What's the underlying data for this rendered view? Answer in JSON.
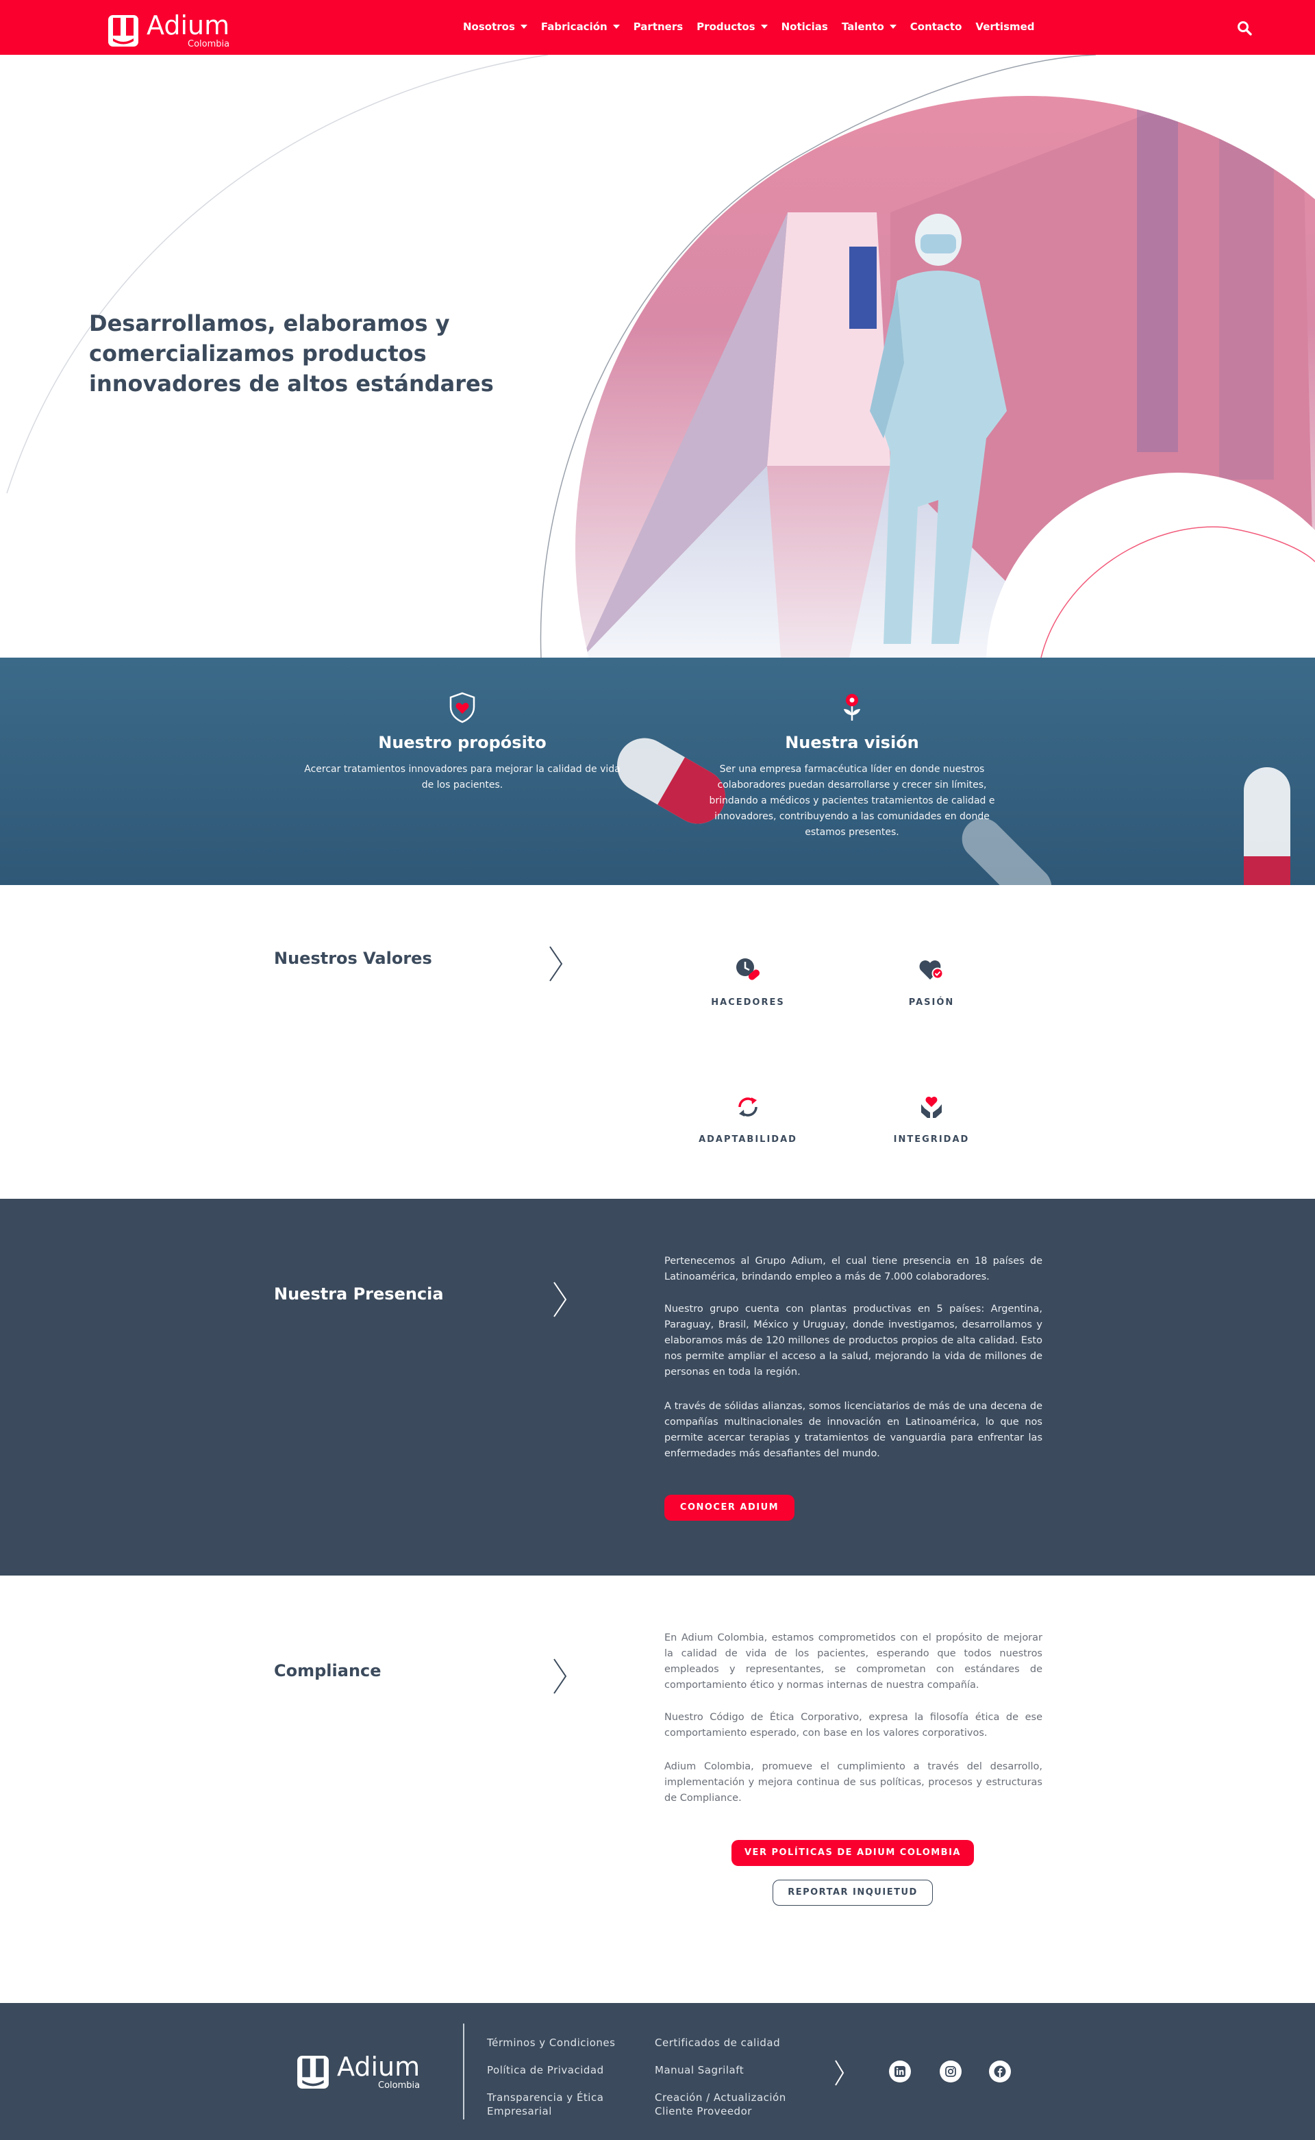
{
  "brand": {
    "name": "Adium",
    "sub": "Colombia"
  },
  "nav": [
    {
      "label": "Nosotros",
      "dropdown": true
    },
    {
      "label": "Fabricación",
      "dropdown": true
    },
    {
      "label": "Partners",
      "dropdown": false
    },
    {
      "label": "Productos",
      "dropdown": true
    },
    {
      "label": "Noticias",
      "dropdown": false
    },
    {
      "label": "Talento",
      "dropdown": true
    },
    {
      "label": "Contacto",
      "dropdown": false
    },
    {
      "label": "Vertismed",
      "dropdown": false
    }
  ],
  "hero": {
    "title": "Desarrollamos, elaboramos y comercializamos productos innovadores de altos estándares"
  },
  "purpose": {
    "title": "Nuestro propósito",
    "text": "Acercar tratamientos innovadores para mejorar la calidad de vida de los pacientes."
  },
  "vision": {
    "title": "Nuestra visión",
    "text": "Ser una empresa farmacéutica líder en donde nuestros colaboradores puedan desarrollarse y crecer sin límites, brindando a médicos y pacientes tratamientos de calidad e innovadores, contribuyendo a las comunidades en donde estamos presentes."
  },
  "values": {
    "title": "Nuestros Valores",
    "items": [
      {
        "label": "HACEDORES",
        "icon": "clock-pill-icon"
      },
      {
        "label": "PASIÓN",
        "icon": "heart-check-icon"
      },
      {
        "label": "ADAPTABILIDAD",
        "icon": "refresh-icon"
      },
      {
        "label": "INTEGRIDAD",
        "icon": "hands-heart-icon"
      }
    ]
  },
  "presence": {
    "title": "Nuestra Presencia",
    "p1": "Pertenecemos al Grupo Adium, el cual tiene presencia en 18 países de Latinoamérica, brindando empleo a más de 7.000 colaboradores.",
    "p2": "Nuestro grupo cuenta con plantas productivas en 5 países: Argentina, Paraguay, Brasil, México y Uruguay, donde investigamos, desarrollamos y elaboramos más de 120 millones de productos propios de alta calidad. Esto nos permite ampliar el acceso a la salud, mejorando la vida de millones de personas en toda la región.",
    "p3": "A través de sólidas alianzas, somos licenciatarios de más de una decena de compañías multinacionales de innovación en Latinoamérica, lo que nos permite acercar terapias y tratamientos de vanguardia para enfrentar las enfermedades más desafiantes del mundo.",
    "button": "CONOCER ADIUM"
  },
  "compliance": {
    "title": "Compliance",
    "p1": "En Adium Colombia, estamos comprometidos con el propósito de mejorar la calidad de vida de los pacientes, esperando que todos nuestros empleados y representantes, se comprometan con estándares de comportamiento ético y normas internas de nuestra compañía.",
    "p2": "Nuestro Código de Ética Corporativo, expresa la filosofía ética de ese comportamiento esperado, con base en los valores corporativos.",
    "p3": "Adium Colombia, promueve el cumplimiento a través del desarrollo, implementación y mejora continua de sus políticas, procesos y estructuras de Compliance.",
    "button_primary": "VER POLÍTICAS DE ADIUM COLOMBIA",
    "button_secondary": "REPORTAR INQUIETUD"
  },
  "footer": {
    "links_col1": [
      "Términos y Condiciones",
      "Política de Privacidad",
      "Transparencia y Ética Empresarial"
    ],
    "links_col2": [
      "Certificados de calidad",
      "Manual Sagrilaft",
      "Creación / Actualización Cliente Proveedor"
    ],
    "social": [
      "linkedin-icon",
      "instagram-icon",
      "facebook-icon"
    ]
  },
  "colors": {
    "brand_red": "#f9002f",
    "navy": "#3b4a5c",
    "band_blue": "#356081"
  }
}
